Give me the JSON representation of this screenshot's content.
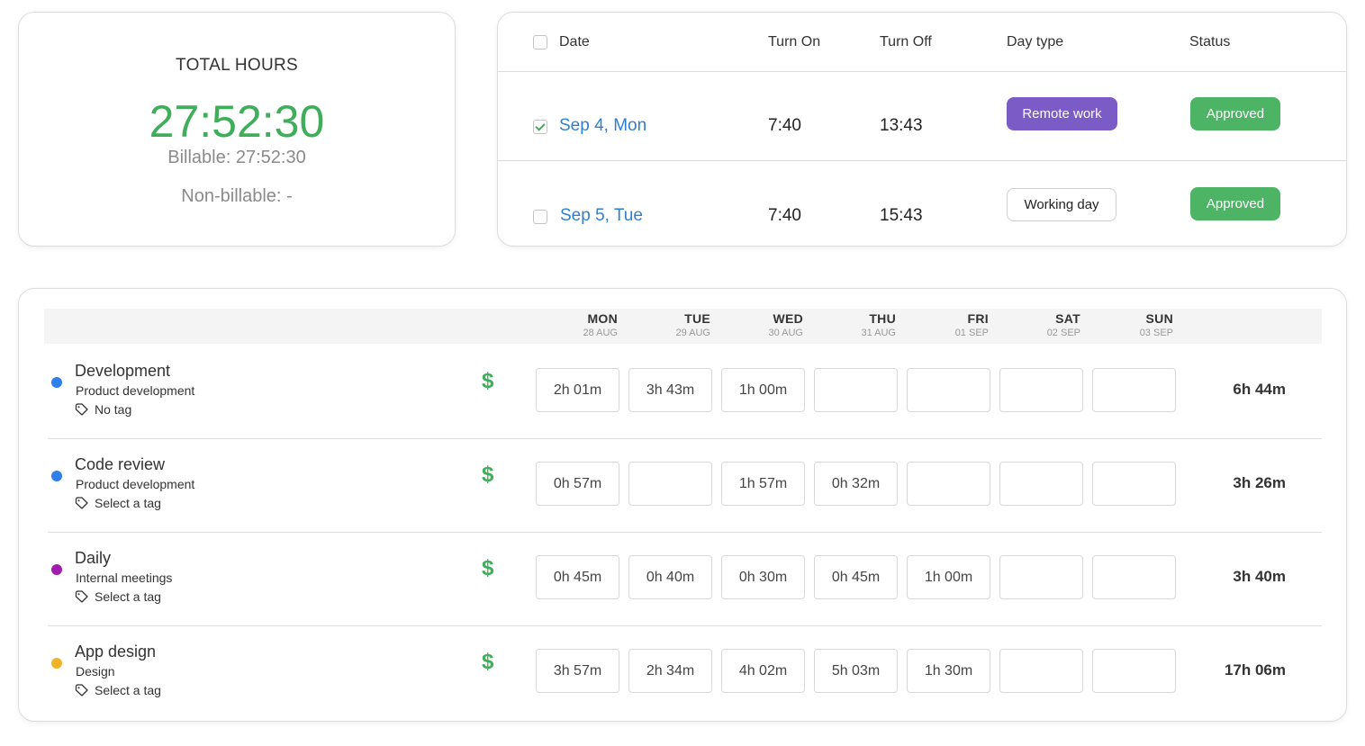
{
  "summary": {
    "title": "TOTAL HOURS",
    "total": "27:52:30",
    "billable": "Billable: 27:52:30",
    "non_billable": "Non-billable: -"
  },
  "days_table": {
    "headers": {
      "date": "Date",
      "turn_on": "Turn On",
      "turn_off": "Turn Off",
      "day_type": "Day type",
      "status": "Status"
    },
    "rows": [
      {
        "date": "Sep 4, Mon",
        "turn_on": "7:40",
        "turn_off": "13:43",
        "day_type": "Remote work",
        "status": "Approved",
        "checked": true
      },
      {
        "date": "Sep 5, Tue",
        "turn_on": "7:40",
        "turn_off": "15:43",
        "day_type": "Working day",
        "status": "Approved",
        "checked": false
      }
    ]
  },
  "timesheet": {
    "days": [
      {
        "name": "MON",
        "date": "28 AUG"
      },
      {
        "name": "TUE",
        "date": "29 AUG"
      },
      {
        "name": "WED",
        "date": "30 AUG"
      },
      {
        "name": "THU",
        "date": "31 AUG"
      },
      {
        "name": "FRI",
        "date": "01 SEP"
      },
      {
        "name": "SAT",
        "date": "02 SEP"
      },
      {
        "name": "SUN",
        "date": "03 SEP"
      }
    ],
    "rows": [
      {
        "task": "Development",
        "project": "Product development",
        "tag": "No tag",
        "color": "#2f80ed",
        "billable_icon": "dollar-icon",
        "times": [
          "2h 01m",
          "3h 43m",
          "1h 00m",
          "",
          "",
          "",
          ""
        ],
        "total": "6h 44m"
      },
      {
        "task": "Code review",
        "project": "Product development",
        "tag": "Select a tag",
        "color": "#2f80ed",
        "billable_icon": "dollar-icon",
        "times": [
          "0h 57m",
          "",
          "1h 57m",
          "0h 32m",
          "",
          "",
          ""
        ],
        "total": "3h 26m"
      },
      {
        "task": "Daily",
        "project": "Internal meetings",
        "tag": "Select a tag",
        "color": "#a21caf",
        "billable_icon": "dollar-icon",
        "times": [
          "0h 45m",
          "0h 40m",
          "0h 30m",
          "0h 45m",
          "1h 00m",
          "",
          ""
        ],
        "total": "3h 40m"
      },
      {
        "task": "App design",
        "project": "Design",
        "tag": "Select a tag",
        "color": "#f0b429",
        "billable_icon": "dollar-icon",
        "times": [
          "3h 57m",
          "2h 34m",
          "4h 02m",
          "5h 03m",
          "1h 30m",
          "",
          ""
        ],
        "total": "17h 06m"
      }
    ]
  },
  "colors": {
    "accent_green": "#3fae5a",
    "approved": "#4cb464",
    "remote_work": "#7b5cc6",
    "link_blue": "#2f7fd0"
  }
}
